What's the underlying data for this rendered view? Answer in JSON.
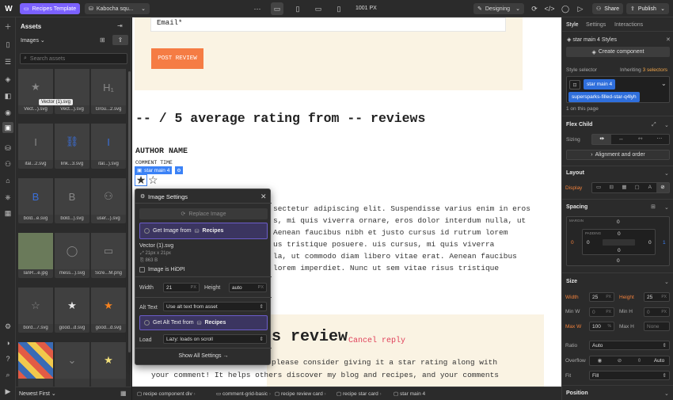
{
  "topbar": {
    "page_label": "Recipes Template",
    "collection_label": "Kabocha squ...",
    "width_readout": "1001 PX",
    "mode_label": "Designing",
    "share_label": "Share",
    "publish_label": "Publish",
    "accent": "#7b61ff"
  },
  "assets": {
    "title": "Assets",
    "filter_label": "Images",
    "search_placeholder": "Search assets",
    "tooltip": "Vector (1).svg",
    "sort_label": "Newest First",
    "tiles": [
      {
        "label": "Vect...).svg",
        "glyph": "★"
      },
      {
        "label": "Vect...).svg",
        "glyph": ""
      },
      {
        "label": "Grou...2.svg",
        "glyph": "H₁"
      },
      {
        "label": "ital...2.svg",
        "glyph": "I"
      },
      {
        "label": "link...3.svg",
        "glyph": "⛓"
      },
      {
        "label": "ital...).svg",
        "glyph": "I"
      },
      {
        "label": "bold...e.svg",
        "glyph": "B"
      },
      {
        "label": "bold...).svg",
        "glyph": "B"
      },
      {
        "label": "user...).svg",
        "glyph": "⚇"
      },
      {
        "label": "IanR...e.jpg",
        "glyph": ""
      },
      {
        "label": "mess...).svg",
        "glyph": "◯"
      },
      {
        "label": "Scre...M.png",
        "glyph": "▭"
      },
      {
        "label": "bord...7.svg",
        "glyph": "☆"
      },
      {
        "label": "good...d.svg",
        "glyph": "★"
      },
      {
        "label": "good...d.svg",
        "glyph": "★"
      },
      {
        "label": "",
        "glyph": ""
      },
      {
        "label": "",
        "glyph": "⌄"
      },
      {
        "label": "",
        "glyph": "★"
      }
    ]
  },
  "canvas": {
    "email_label": "Email*",
    "post_review": "POST REVIEW",
    "rating_heading": "-- / 5 average rating from -- reviews",
    "author_name": "AUTHOR NAME",
    "comment_time": "COMMENT TIME",
    "selected_tag": "star main 4",
    "body_lines": [
      "sectetur adipiscing elit. Suspendisse varius enim in eros",
      "s, mi quis viverra ornare, eros dolor interdum nulla, ut",
      "Aenean faucibus nibh et justo cursus id rutrum lorem",
      "us tristique posuere. uis cursus, mi quis viverra",
      "la, ut commodo diam libero vitae erat. Aenean faucibus",
      "lorem imperdiet. Nunc ut sem vitae risus tristique"
    ],
    "review_heading": "s review",
    "cancel_reply": "Cancel reply",
    "footer_lines": [
      "please consider giving it a star rating along with",
      "your comment! It helps others discover my blog and recipes, and your comments"
    ],
    "accent_orange": "#f57c44"
  },
  "dialog": {
    "title": "Image Settings",
    "replace_image": "Replace Image",
    "get_image_from": "Get Image from",
    "recipes_label": "Recipes",
    "file_name": "Vector (1).svg",
    "file_dims": "21px x 21px",
    "file_size": "863 B",
    "hidpi_label": "Image is HiDPI",
    "width_label": "Width",
    "width_value": "21",
    "height_label": "Height",
    "height_value": "auto",
    "px": "PX",
    "alt_label": "Alt Text",
    "alt_value": "Use alt text from asset",
    "get_alt_from": "Get Alt Text from",
    "load_label": "Load",
    "load_value": "Lazy: loads on scroll",
    "show_all": "Show All Settings"
  },
  "breadcrumbs": [
    "recipe component div",
    "comment-grid-basic",
    "recipe review card",
    "recipe star card",
    "star main 4"
  ],
  "right": {
    "tabs": [
      "Style",
      "Settings",
      "Interactions"
    ],
    "component_name": "star main 4 Styles",
    "create_component": "Create component",
    "selector_label": "Style selector",
    "inheriting": "Inheriting",
    "inheriting_count": "3 selectors",
    "selector_chip": "star main 4",
    "selector_chip2": "supersparks-filled-star-q4lyh",
    "on_page": "1 on this page",
    "flex_child": "Flex Child",
    "sizing": "Sizing",
    "align_order": "Alignment and order",
    "layout": "Layout",
    "display": "Display",
    "spacing": "Spacing",
    "margin": "MARGIN",
    "padding": "PADDING",
    "margin_left": "0",
    "margin_right": "1",
    "zero": "0",
    "size": "Size",
    "width_label": "Width",
    "width_value": "25",
    "height_label": "Height",
    "height_value": "25",
    "minw": "Min W",
    "minh": "Min H",
    "maxw": "Max W",
    "maxh": "Max H",
    "maxw_value": "100",
    "unit_px": "PX",
    "unit_pct": "%",
    "none": "None",
    "ratio": "Ratio",
    "ratio_value": "Auto",
    "overflow": "Overflow",
    "overflow_auto": "Auto",
    "fit": "Fit",
    "fit_value": "Fill",
    "position": "Position",
    "highlight": "#f0803c"
  }
}
